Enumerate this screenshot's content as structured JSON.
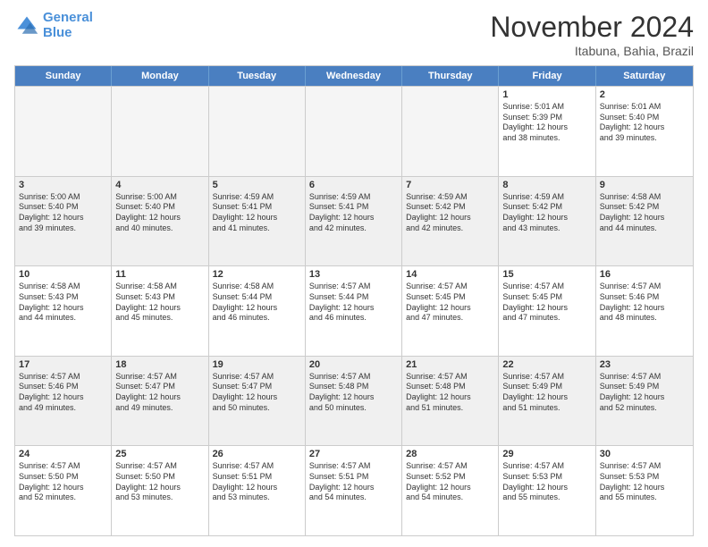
{
  "logo": {
    "line1": "General",
    "line2": "Blue"
  },
  "title": "November 2024",
  "location": "Itabuna, Bahia, Brazil",
  "days_of_week": [
    "Sunday",
    "Monday",
    "Tuesday",
    "Wednesday",
    "Thursday",
    "Friday",
    "Saturday"
  ],
  "weeks": [
    [
      {
        "day": "",
        "info": "",
        "empty": true
      },
      {
        "day": "",
        "info": "",
        "empty": true
      },
      {
        "day": "",
        "info": "",
        "empty": true
      },
      {
        "day": "",
        "info": "",
        "empty": true
      },
      {
        "day": "",
        "info": "",
        "empty": true
      },
      {
        "day": "1",
        "info": "Sunrise: 5:01 AM\nSunset: 5:39 PM\nDaylight: 12 hours\nand 38 minutes.",
        "empty": false
      },
      {
        "day": "2",
        "info": "Sunrise: 5:01 AM\nSunset: 5:40 PM\nDaylight: 12 hours\nand 39 minutes.",
        "empty": false
      }
    ],
    [
      {
        "day": "3",
        "info": "Sunrise: 5:00 AM\nSunset: 5:40 PM\nDaylight: 12 hours\nand 39 minutes.",
        "empty": false
      },
      {
        "day": "4",
        "info": "Sunrise: 5:00 AM\nSunset: 5:40 PM\nDaylight: 12 hours\nand 40 minutes.",
        "empty": false
      },
      {
        "day": "5",
        "info": "Sunrise: 4:59 AM\nSunset: 5:41 PM\nDaylight: 12 hours\nand 41 minutes.",
        "empty": false
      },
      {
        "day": "6",
        "info": "Sunrise: 4:59 AM\nSunset: 5:41 PM\nDaylight: 12 hours\nand 42 minutes.",
        "empty": false
      },
      {
        "day": "7",
        "info": "Sunrise: 4:59 AM\nSunset: 5:42 PM\nDaylight: 12 hours\nand 42 minutes.",
        "empty": false
      },
      {
        "day": "8",
        "info": "Sunrise: 4:59 AM\nSunset: 5:42 PM\nDaylight: 12 hours\nand 43 minutes.",
        "empty": false
      },
      {
        "day": "9",
        "info": "Sunrise: 4:58 AM\nSunset: 5:42 PM\nDaylight: 12 hours\nand 44 minutes.",
        "empty": false
      }
    ],
    [
      {
        "day": "10",
        "info": "Sunrise: 4:58 AM\nSunset: 5:43 PM\nDaylight: 12 hours\nand 44 minutes.",
        "empty": false
      },
      {
        "day": "11",
        "info": "Sunrise: 4:58 AM\nSunset: 5:43 PM\nDaylight: 12 hours\nand 45 minutes.",
        "empty": false
      },
      {
        "day": "12",
        "info": "Sunrise: 4:58 AM\nSunset: 5:44 PM\nDaylight: 12 hours\nand 46 minutes.",
        "empty": false
      },
      {
        "day": "13",
        "info": "Sunrise: 4:57 AM\nSunset: 5:44 PM\nDaylight: 12 hours\nand 46 minutes.",
        "empty": false
      },
      {
        "day": "14",
        "info": "Sunrise: 4:57 AM\nSunset: 5:45 PM\nDaylight: 12 hours\nand 47 minutes.",
        "empty": false
      },
      {
        "day": "15",
        "info": "Sunrise: 4:57 AM\nSunset: 5:45 PM\nDaylight: 12 hours\nand 47 minutes.",
        "empty": false
      },
      {
        "day": "16",
        "info": "Sunrise: 4:57 AM\nSunset: 5:46 PM\nDaylight: 12 hours\nand 48 minutes.",
        "empty": false
      }
    ],
    [
      {
        "day": "17",
        "info": "Sunrise: 4:57 AM\nSunset: 5:46 PM\nDaylight: 12 hours\nand 49 minutes.",
        "empty": false
      },
      {
        "day": "18",
        "info": "Sunrise: 4:57 AM\nSunset: 5:47 PM\nDaylight: 12 hours\nand 49 minutes.",
        "empty": false
      },
      {
        "day": "19",
        "info": "Sunrise: 4:57 AM\nSunset: 5:47 PM\nDaylight: 12 hours\nand 50 minutes.",
        "empty": false
      },
      {
        "day": "20",
        "info": "Sunrise: 4:57 AM\nSunset: 5:48 PM\nDaylight: 12 hours\nand 50 minutes.",
        "empty": false
      },
      {
        "day": "21",
        "info": "Sunrise: 4:57 AM\nSunset: 5:48 PM\nDaylight: 12 hours\nand 51 minutes.",
        "empty": false
      },
      {
        "day": "22",
        "info": "Sunrise: 4:57 AM\nSunset: 5:49 PM\nDaylight: 12 hours\nand 51 minutes.",
        "empty": false
      },
      {
        "day": "23",
        "info": "Sunrise: 4:57 AM\nSunset: 5:49 PM\nDaylight: 12 hours\nand 52 minutes.",
        "empty": false
      }
    ],
    [
      {
        "day": "24",
        "info": "Sunrise: 4:57 AM\nSunset: 5:50 PM\nDaylight: 12 hours\nand 52 minutes.",
        "empty": false
      },
      {
        "day": "25",
        "info": "Sunrise: 4:57 AM\nSunset: 5:50 PM\nDaylight: 12 hours\nand 53 minutes.",
        "empty": false
      },
      {
        "day": "26",
        "info": "Sunrise: 4:57 AM\nSunset: 5:51 PM\nDaylight: 12 hours\nand 53 minutes.",
        "empty": false
      },
      {
        "day": "27",
        "info": "Sunrise: 4:57 AM\nSunset: 5:51 PM\nDaylight: 12 hours\nand 54 minutes.",
        "empty": false
      },
      {
        "day": "28",
        "info": "Sunrise: 4:57 AM\nSunset: 5:52 PM\nDaylight: 12 hours\nand 54 minutes.",
        "empty": false
      },
      {
        "day": "29",
        "info": "Sunrise: 4:57 AM\nSunset: 5:53 PM\nDaylight: 12 hours\nand 55 minutes.",
        "empty": false
      },
      {
        "day": "30",
        "info": "Sunrise: 4:57 AM\nSunset: 5:53 PM\nDaylight: 12 hours\nand 55 minutes.",
        "empty": false
      }
    ]
  ]
}
